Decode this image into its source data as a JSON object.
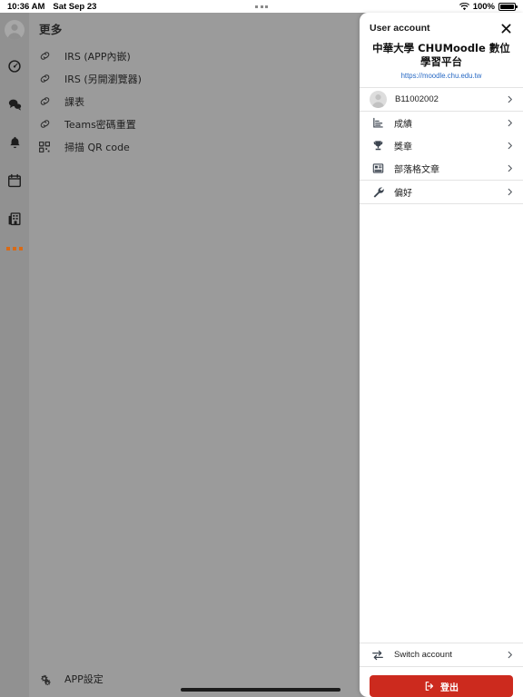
{
  "statusbar": {
    "time": "10:36 AM",
    "date": "Sat Sep 23",
    "battery_percent": "100%",
    "wifi_icon": "wifi-icon",
    "battery_icon": "battery-full-icon",
    "multitask_icon": "multitask-dots-icon"
  },
  "rail": {
    "avatar_icon": "user-avatar-icon",
    "items": [
      {
        "icon": "dashboard-speedometer-icon",
        "name": "dashboard"
      },
      {
        "icon": "chat-bubbles-icon",
        "name": "messages"
      },
      {
        "icon": "bell-icon",
        "name": "notifications"
      },
      {
        "icon": "calendar-icon",
        "name": "calendar"
      },
      {
        "icon": "building-icon",
        "name": "site-home"
      }
    ],
    "more_icon": "more-dots-icon"
  },
  "left_panel": {
    "title": "更多",
    "items": [
      {
        "label": "IRS (APP內嵌)",
        "icon": "link-icon"
      },
      {
        "label": "IRS (另開瀏覽器)",
        "icon": "link-icon"
      },
      {
        "label": "課表",
        "icon": "link-icon"
      },
      {
        "label": "Teams密碼重置",
        "icon": "link-icon"
      },
      {
        "label": "掃描 QR code",
        "icon": "qr-code-icon"
      }
    ],
    "footer": {
      "label": "APP設定",
      "icon": "gears-icon"
    }
  },
  "sheet": {
    "header_title": "User account",
    "close_icon": "close-icon",
    "site_title": "中華大學 CHUMoodle 數位學習平台",
    "site_url": "https://moodle.chu.edu.tw",
    "user": {
      "name": "B11002002",
      "avatar_icon": "user-avatar-icon"
    },
    "menu": [
      {
        "label": "成績",
        "icon": "grades-chart-icon"
      },
      {
        "label": "獎章",
        "icon": "trophy-icon"
      },
      {
        "label": "部落格文章",
        "icon": "newspaper-icon"
      },
      {
        "label": "偏好",
        "icon": "wrench-icon"
      }
    ],
    "switch_account": {
      "label": "Switch account",
      "icon": "switch-arrows-icon"
    },
    "logout": {
      "label": "登出",
      "icon": "logout-icon"
    }
  },
  "colors": {
    "logout_red": "#cc2a1e",
    "link_blue": "#2769c4",
    "accent_orange": "#d96a16",
    "backdrop_gray": "#999999"
  }
}
